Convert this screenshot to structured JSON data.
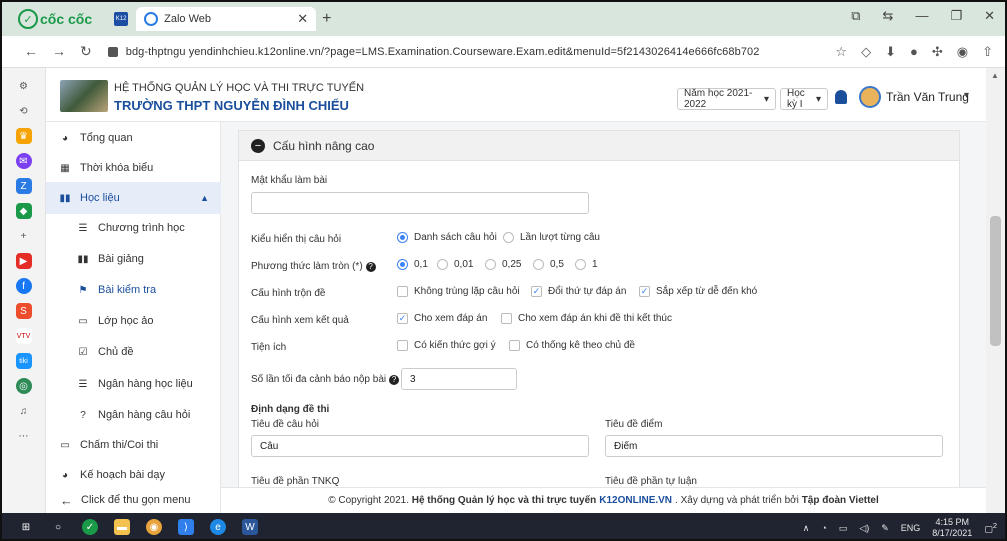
{
  "browser": {
    "brand": "cốc cốc",
    "tab_k12_icon": "K12",
    "tab_active_label": "Zalo Web",
    "url": "bdg-thptngu yendinhchieu.k12online.vn/?page=LMS.Examination.Courseware.Exam.edit&menuId=5f2143026414e666fc68b702"
  },
  "header": {
    "system_title": "HỆ THỐNG QUẢN LÝ HỌC VÀ THI TRỰC TUYẾN",
    "school_name": "TRƯỜNG THPT NGUYỄN ĐÌNH CHIỂU",
    "school_year": "Năm học 2021-2022",
    "semester": "Học kỳ I",
    "user_name": "Trần Văn Trung"
  },
  "sidebar": {
    "items": [
      {
        "label": "Tổng quan"
      },
      {
        "label": "Thời khóa biểu"
      },
      {
        "label": "Học liệu"
      },
      {
        "label": "Chương trình học"
      },
      {
        "label": "Bài giảng"
      },
      {
        "label": "Bài kiểm tra"
      },
      {
        "label": "Lớp học ảo"
      },
      {
        "label": "Chủ đề"
      },
      {
        "label": "Ngân hàng học liệu"
      },
      {
        "label": "Ngân hàng câu hỏi"
      },
      {
        "label": "Chấm thi/Coi thi"
      },
      {
        "label": "Kế hoạch bài dạy"
      }
    ],
    "collapse_label": "Click để thu gọn menu"
  },
  "form": {
    "section_title": "Cấu hình nâng cao",
    "password_label": "Mật khẩu làm bài",
    "password_value": "",
    "display_label": "Kiểu hiển thị câu hỏi",
    "display_opt1": "Danh sách câu hỏi",
    "display_opt2": "Lần lượt từng câu",
    "rounding_label": "Phương thức làm tròn (*)",
    "rounding_opts": [
      "0,1",
      "0,01",
      "0,25",
      "0,5",
      "1"
    ],
    "shuffle_label": "Cấu hình trộn đề",
    "shuffle_opt1": "Không trùng lặp câu hỏi",
    "shuffle_opt2": "Đổi thứ tự đáp án",
    "shuffle_opt3": "Sắp xếp từ dễ đến khó",
    "result_label": "Cấu hình xem kết quả",
    "result_opt1": "Cho xem đáp án",
    "result_opt2": "Cho xem đáp án khi đề thi kết thúc",
    "util_label": "Tiện ích",
    "util_opt1": "Có kiến thức gợi ý",
    "util_opt2": "Có thống kê theo chủ đề",
    "warn_label": "Số lần tối đa cảnh báo nộp bài",
    "warn_value": "3",
    "format_title": "Định dạng đề thi",
    "question_title_label": "Tiêu đề câu hỏi",
    "question_title_value": "Câu",
    "score_title_label": "Tiêu đề điểm",
    "score_title_value": "Điểm",
    "tnkq_label": "Tiêu đề phần TNKQ",
    "essay_label": "Tiêu đề phần tự luận"
  },
  "footer": {
    "prefix": "© Copyright 2021.",
    "system": "Hệ thống Quản lý học và thi trực tuyến",
    "site": "K12ONLINE.VN",
    "middle": ". Xây dựng và phát triển bởi",
    "owner": "Tập đoàn Viettel"
  },
  "taskbar": {
    "lang": "ENG",
    "time": "4:15 PM",
    "date": "8/17/2021",
    "notif_count": "2"
  }
}
